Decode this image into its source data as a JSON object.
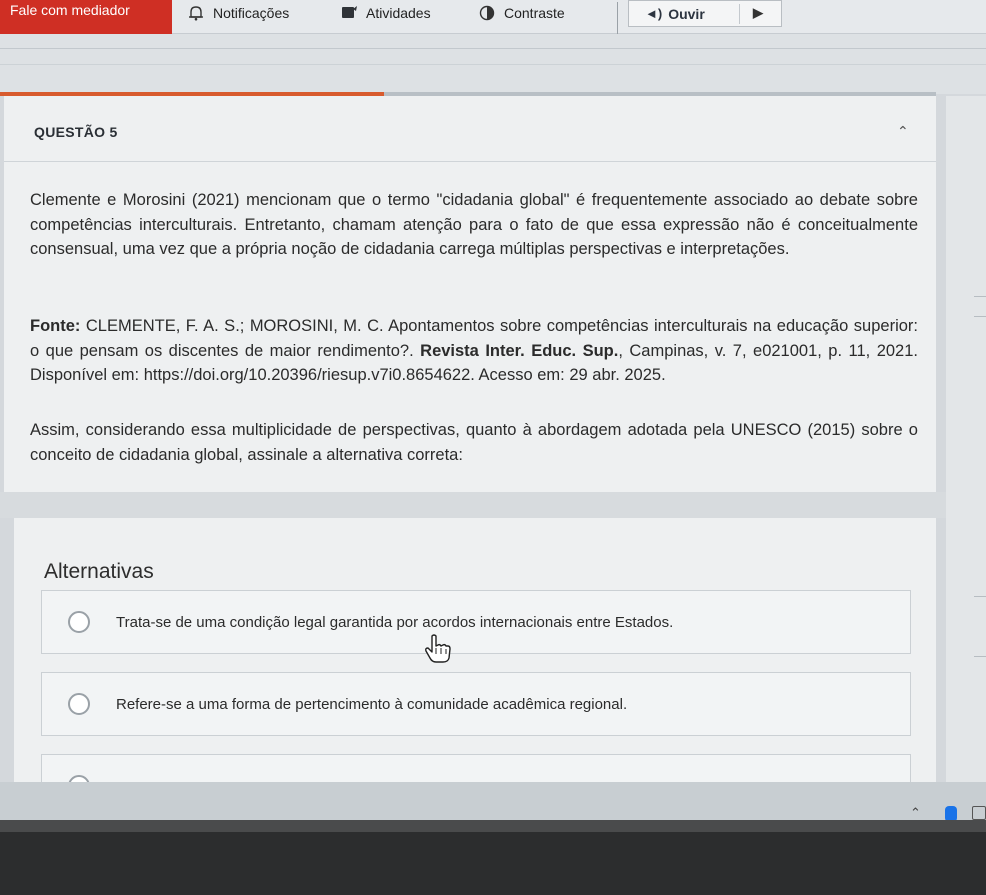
{
  "toolbar": {
    "mediator_label": "Fale com mediador",
    "notifications_label": "Notificações",
    "activities_label": "Atividades",
    "contrast_label": "Contraste",
    "listen_label": "Ouvir",
    "progress_percent": 41,
    "icons": [
      "bell-icon",
      "tablet-icon",
      "contrast-icon",
      "speaker-icon",
      "play-icon"
    ]
  },
  "question": {
    "title": "QUESTÃO 5",
    "paragraph1": "Clemente e Morosini (2021) mencionam que o termo \"cidadania global\" é frequentemente associado ao debate sobre competências interculturais. Entretanto, chamam atenção para o fato de que essa expressão não é conceitualmente consensual, uma vez que a própria noção de cidadania carrega múltiplas perspectivas e interpretações.",
    "source_label": "Fonte:",
    "source_part1": " CLEMENTE, F. A. S.; MOROSINI, M. C. Apontamentos sobre competências interculturais na educação superior: o que pensam os discentes de maior rendimento?. ",
    "source_journal": "Revista Inter. Educ. Sup.",
    "source_part2": ", Campinas, v. 7, e021001, p. 11, 2021. Disponível em: https://doi.org/10.20396/riesup.v7i0.8654622. Acesso em: 29 abr. 2025.",
    "paragraph3": "Assim, considerando essa multiplicidade de perspectivas, quanto à abordagem adotada pela UNESCO (2015) sobre o conceito de cidadania global, assinale a alternativa correta:"
  },
  "alternatives": {
    "heading": "Alternativas",
    "options": [
      "Trata-se de uma condição legal garantida por acordos internacionais entre Estados.",
      "Refere-se a uma forma de pertencimento à comunidade acadêmica regional."
    ]
  },
  "colors": {
    "mediator_red": "#cf2f24",
    "progress_orange": "#d85b2e",
    "tray_blue": "#1a73e8"
  }
}
